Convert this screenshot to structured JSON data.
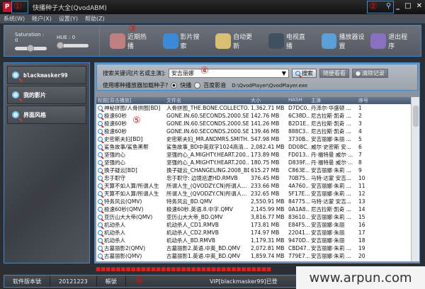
{
  "window": {
    "title": "快播种子大全(QvodABM)",
    "logo": "P"
  },
  "menu": [
    "系统(W)",
    "帐户(X)",
    "设置(Y)",
    "帮助(Z)"
  ],
  "toolbar": {
    "saturation_label": "Saturation : 0",
    "hue_label": "HUE : 0",
    "saturation": 0,
    "hue": 0,
    "tools": [
      {
        "label": "近期热播",
        "icon": "hot-icon",
        "color": "#c08080"
      },
      {
        "label": "影片搜索",
        "icon": "info-icon",
        "color": "#3a8ad8"
      },
      {
        "label": "自动更新",
        "icon": "update-icon",
        "color": "#d8c070"
      },
      {
        "label": "电视直播",
        "icon": "tv-icon",
        "color": "#405060"
      },
      {
        "label": "播放器设置",
        "icon": "settings-icon",
        "color": "#5aa0d8"
      }
    ],
    "exit_label": "退出程序"
  },
  "sidebar": {
    "items": [
      "blackmasker99",
      "我的影片",
      "界面风格"
    ]
  },
  "search": {
    "label": "搜索关键词[片名或主演]:",
    "value": "安吉丽娜",
    "search_btn": "搜索",
    "random_btn": "随便看看",
    "clear_btn": "清除记录",
    "player_question": "使用哪种播放器加载种子?",
    "player_options": [
      "快播",
      "百度影音"
    ],
    "selected_player": "快播",
    "player_path": "D:\\QvodPlayer\\QvodPlayer.exe"
  },
  "table": {
    "headers": [
      "标题[双击播放]",
      "文件名",
      "大小",
      "HASH",
      "主演",
      "序号"
    ],
    "rows": [
      [
        "神秘拼图/人骨拼图[BD]",
        "人骨拼图_THE.BONE.COLLECTO...",
        "1,362.71 MB",
        "D7DC0...",
        "丹泽尔·华盛顿 ...",
        "1"
      ],
      [
        "极速60秒",
        "GONE.IN.60.SECONDS.2000.SE.X...",
        "142.76 MB",
        "6C38D...",
        "尼古拉斯·凯奇 ...",
        "2"
      ],
      [
        "极速60秒",
        "GONE.IN.60.SECONDS.2000.SE.X...",
        "141.26 MB",
        "B2D1E...",
        "尼古拉斯·凯奇 ...",
        "3"
      ],
      [
        "极速60秒",
        "GONE.IN.60.SECONDS.2000.SE.X...",
        "139.46 MB",
        "888C3...",
        "尼古拉斯·凯奇 ...",
        "4"
      ],
      [
        "史密斯夫妇[BD]",
        "史密斯夫妇_MR.ANDMRS.SMITH...",
        "547.98 MB",
        "3730B...",
        "安吉丽娜·朱丽 ...",
        "5"
      ],
      [
        "鲨鱼故事/鲨鱼黑帮",
        "鲨鱼故事_BD中英双字1024高清...",
        "2,082.41 MB",
        "DD08C...",
        "威尔·史密斯 安...",
        "6"
      ],
      [
        "坚强的心",
        "坚强的心_A.MIGHTY.HEART.200...",
        "173.89 MB",
        "FD013...",
        "丹·福特曼 威尔·...",
        "7"
      ],
      [
        "坚强的心",
        "坚强的心_A.MIGHTY.HEART.200...",
        "180.75 MB",
        "D839F...",
        "丹·福特曼 威尔·...",
        "8"
      ],
      [
        "换子疑云[BD]",
        "换子疑云_CHANGELING.2008_BD...",
        "615.27 MB",
        "C863E...",
        "安吉丽娜·朱莉 ...",
        "9"
      ],
      [
        "忠于职守",
        "忠于职守: 边境巡逻HD.RMVB",
        "376.45 MB",
        "70B75...",
        "马特·达蒙 安吉...",
        "10"
      ],
      [
        "天算不如人算/所谓人生",
        "所谓人生_(QVODZY.CN)所谓人...",
        "233.66 MB",
        "4A760...",
        "安吉丽娜·朱莉 ...",
        "11"
      ],
      [
        "天算不如人算/所谓人生",
        "所谓人生_(QVODZY.CN)所谓人...",
        "232.65 MB",
        "5F17E...",
        "安吉丽娜·朱莉 ...",
        "12"
      ],
      [
        "特务风云(QMV)",
        "特务风云_BD.QMV",
        "2,550.91 MB",
        "84775...",
        "马特·达蒙 安吉...",
        "13"
      ],
      [
        "极速60秒(QMV)",
        "极速60秒.英语.8.中字.QMV",
        "2,145.99 MB",
        "0A1A8...",
        "尼古拉斯·凯奇 ...",
        "14"
      ],
      [
        "亚历山大大帝(QMV)",
        "亚历山大大帝_BD.QMV",
        "3,816.77 MB",
        "83610...",
        "安吉丽娜·朱莉 ...",
        "15"
      ],
      [
        "机动杀人",
        "机动杀人_CD1.RMVB",
        "173.81 MB",
        "E84F5...",
        "安吉丽娜·朱丽",
        "16"
      ],
      [
        "机动杀人",
        "机动杀人_CD2.RMVB",
        "174.97 MB",
        "22041...",
        "安吉丽娜·朱丽",
        "17"
      ],
      [
        "机动杀人",
        "机动杀人_BD.RMVB",
        "1,179.31 MB",
        "9470D...",
        "安吉丽娜·朱丽",
        "18"
      ],
      [
        "古墓丽影2(QMV)",
        "古墓丽影2.英语.中英_BD.QMV",
        "2,072.81 MB",
        "CBD47...",
        "安吉丽娜·朱莉 ...",
        "19"
      ],
      [
        "古墓丽影(QMV)",
        "古墓丽影1.英语.中英_BD.QMV",
        "1,859.74 MB",
        "779E7...",
        "安吉丽娜·朱莉 ...",
        "20"
      ]
    ]
  },
  "status": {
    "version_label": "软件版本號",
    "version": "20121223",
    "account_label": "帳號",
    "vip": "VIP[blackmasker99]已登"
  },
  "watermark": "www.arpun.com",
  "annotations": [
    "①",
    "②",
    "③",
    "④",
    "⑤",
    "⑥"
  ]
}
